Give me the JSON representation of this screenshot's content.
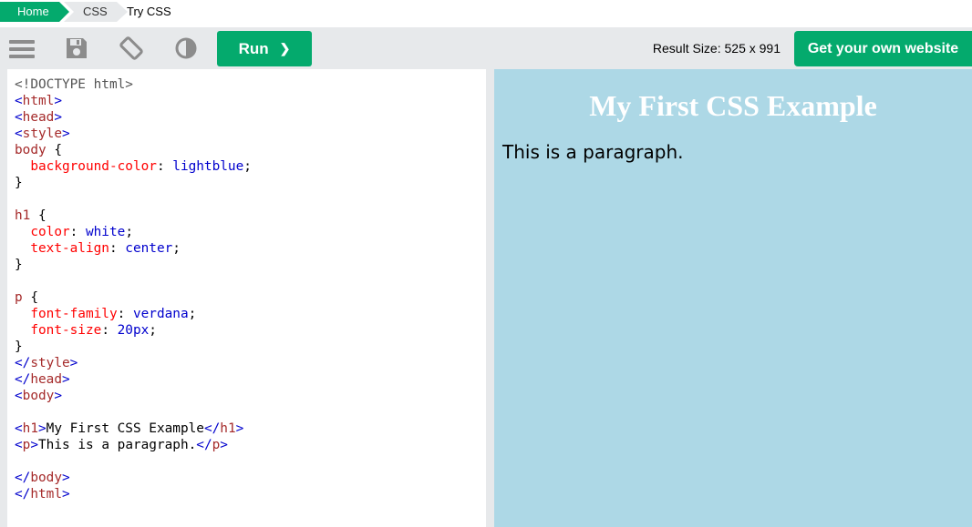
{
  "breadcrumb": {
    "home": "Home",
    "css": "CSS",
    "current": "Try CSS"
  },
  "toolbar": {
    "run_label": "Run",
    "run_arrow": "❯",
    "result_size": "Result Size: 525 x 991",
    "own_website": "Get your own website"
  },
  "icons": {
    "menu": "hamburger-icon",
    "save": "save-icon",
    "rotate": "rotate-icon",
    "theme": "contrast-icon"
  },
  "colors": {
    "accent": "#04aa6d",
    "toolbar_bg": "#e7e9eb",
    "result_bg": "#add8e6"
  },
  "code_lines": [
    "<!DOCTYPE html>",
    "<html>",
    "<head>",
    "<style>",
    "body {",
    "  background-color: lightblue;",
    "}",
    "",
    "h1 {",
    "  color: white;",
    "  text-align: center;",
    "}",
    "",
    "p {",
    "  font-family: verdana;",
    "  font-size: 20px;",
    "}",
    "</style>",
    "</head>",
    "<body>",
    "",
    "<h1>My First CSS Example</h1>",
    "<p>This is a paragraph.</p>",
    "",
    "</body>",
    "</html>"
  ],
  "result": {
    "heading": "My First CSS Example",
    "paragraph": "This is a paragraph."
  }
}
